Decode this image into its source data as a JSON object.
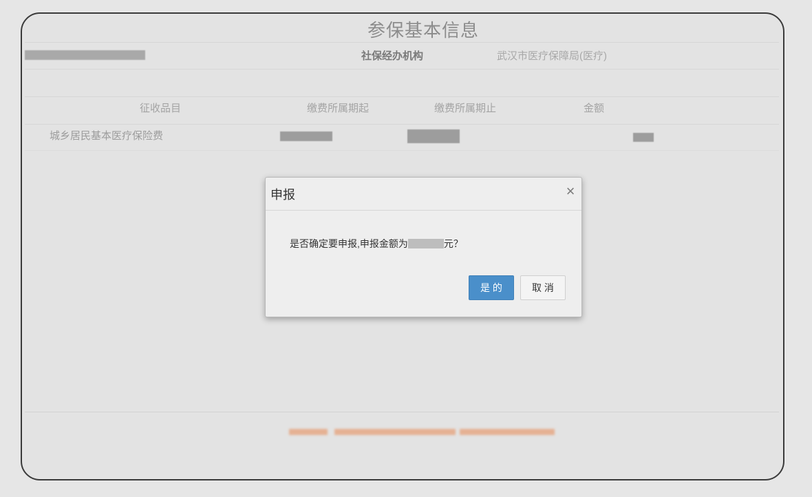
{
  "page": {
    "title": "参保基本信息"
  },
  "info": {
    "label": "社保经办机构",
    "value": "武汉市医疗保障局(医疗)"
  },
  "table": {
    "headers": [
      "征收品目",
      "缴费所属期起",
      "缴费所属期止",
      "金额"
    ],
    "rows": [
      {
        "item": "城乡居民基本医疗保险费"
      }
    ]
  },
  "dialog": {
    "title": "申报",
    "close": "×",
    "message_prefix": "是否确定要申报,申报金额为",
    "message_suffix": "元？",
    "confirm_label": "是 的",
    "cancel_label": "取 消"
  },
  "icons": {
    "close": "close-icon"
  },
  "colors": {
    "accent": "#4a8fca",
    "notice": "#e6a580",
    "title_text": "#8c8c8c"
  }
}
